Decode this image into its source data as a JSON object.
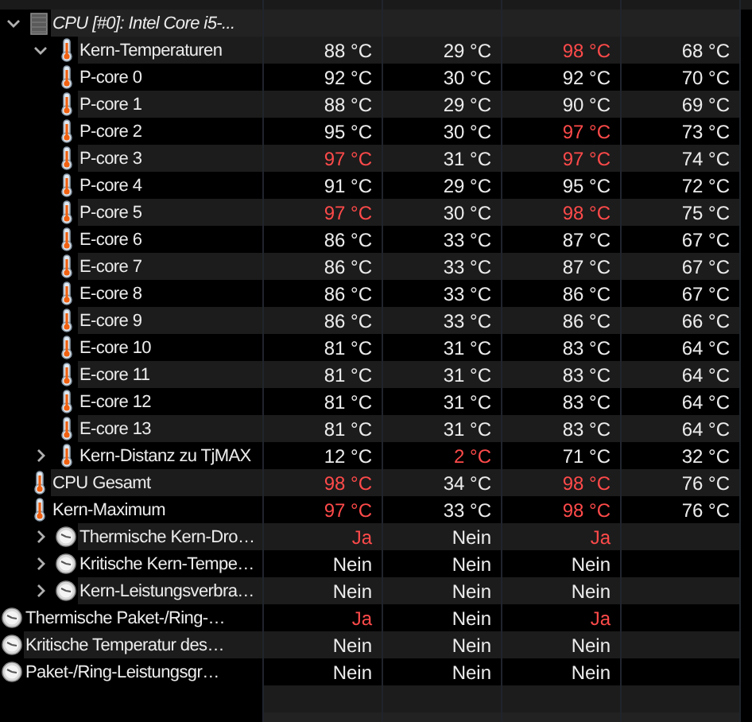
{
  "tree": [
    {
      "label": "CPU [#0]: Intel Core i5-...",
      "kind": "group",
      "expanded": true,
      "children": [
        {
          "label": "Kern-Temperaturen",
          "kind": "temperature",
          "expanded": true,
          "values": [
            {
              "text": "88 °C",
              "alert": false
            },
            {
              "text": "29 °C",
              "alert": false
            },
            {
              "text": "98 °C",
              "alert": true
            },
            {
              "text": "68 °C",
              "alert": false
            }
          ],
          "children": [
            {
              "label": "P-core 0",
              "kind": "temperature",
              "values": [
                {
                  "text": "92 °C",
                  "alert": false
                },
                {
                  "text": "30 °C",
                  "alert": false
                },
                {
                  "text": "92 °C",
                  "alert": false
                },
                {
                  "text": "70 °C",
                  "alert": false
                }
              ]
            },
            {
              "label": "P-core 1",
              "kind": "temperature",
              "values": [
                {
                  "text": "88 °C",
                  "alert": false
                },
                {
                  "text": "29 °C",
                  "alert": false
                },
                {
                  "text": "90 °C",
                  "alert": false
                },
                {
                  "text": "69 °C",
                  "alert": false
                }
              ]
            },
            {
              "label": "P-core 2",
              "kind": "temperature",
              "values": [
                {
                  "text": "95 °C",
                  "alert": false
                },
                {
                  "text": "30 °C",
                  "alert": false
                },
                {
                  "text": "97 °C",
                  "alert": true
                },
                {
                  "text": "73 °C",
                  "alert": false
                }
              ]
            },
            {
              "label": "P-core 3",
              "kind": "temperature",
              "values": [
                {
                  "text": "97 °C",
                  "alert": true
                },
                {
                  "text": "31 °C",
                  "alert": false
                },
                {
                  "text": "97 °C",
                  "alert": true
                },
                {
                  "text": "74 °C",
                  "alert": false
                }
              ]
            },
            {
              "label": "P-core 4",
              "kind": "temperature",
              "values": [
                {
                  "text": "91 °C",
                  "alert": false
                },
                {
                  "text": "29 °C",
                  "alert": false
                },
                {
                  "text": "95 °C",
                  "alert": false
                },
                {
                  "text": "72 °C",
                  "alert": false
                }
              ]
            },
            {
              "label": "P-core 5",
              "kind": "temperature",
              "values": [
                {
                  "text": "97 °C",
                  "alert": true
                },
                {
                  "text": "30 °C",
                  "alert": false
                },
                {
                  "text": "98 °C",
                  "alert": true
                },
                {
                  "text": "75 °C",
                  "alert": false
                }
              ]
            },
            {
              "label": "E-core 6",
              "kind": "temperature",
              "values": [
                {
                  "text": "86 °C",
                  "alert": false
                },
                {
                  "text": "33 °C",
                  "alert": false
                },
                {
                  "text": "87 °C",
                  "alert": false
                },
                {
                  "text": "67 °C",
                  "alert": false
                }
              ]
            },
            {
              "label": "E-core 7",
              "kind": "temperature",
              "values": [
                {
                  "text": "86 °C",
                  "alert": false
                },
                {
                  "text": "33 °C",
                  "alert": false
                },
                {
                  "text": "87 °C",
                  "alert": false
                },
                {
                  "text": "67 °C",
                  "alert": false
                }
              ]
            },
            {
              "label": "E-core 8",
              "kind": "temperature",
              "values": [
                {
                  "text": "86 °C",
                  "alert": false
                },
                {
                  "text": "33 °C",
                  "alert": false
                },
                {
                  "text": "86 °C",
                  "alert": false
                },
                {
                  "text": "67 °C",
                  "alert": false
                }
              ]
            },
            {
              "label": "E-core 9",
              "kind": "temperature",
              "values": [
                {
                  "text": "86 °C",
                  "alert": false
                },
                {
                  "text": "33 °C",
                  "alert": false
                },
                {
                  "text": "86 °C",
                  "alert": false
                },
                {
                  "text": "66 °C",
                  "alert": false
                }
              ]
            },
            {
              "label": "E-core 10",
              "kind": "temperature",
              "values": [
                {
                  "text": "81 °C",
                  "alert": false
                },
                {
                  "text": "31 °C",
                  "alert": false
                },
                {
                  "text": "83 °C",
                  "alert": false
                },
                {
                  "text": "64 °C",
                  "alert": false
                }
              ]
            },
            {
              "label": "E-core 11",
              "kind": "temperature",
              "values": [
                {
                  "text": "81 °C",
                  "alert": false
                },
                {
                  "text": "31 °C",
                  "alert": false
                },
                {
                  "text": "83 °C",
                  "alert": false
                },
                {
                  "text": "64 °C",
                  "alert": false
                }
              ]
            },
            {
              "label": "E-core 12",
              "kind": "temperature",
              "values": [
                {
                  "text": "81 °C",
                  "alert": false
                },
                {
                  "text": "31 °C",
                  "alert": false
                },
                {
                  "text": "83 °C",
                  "alert": false
                },
                {
                  "text": "64 °C",
                  "alert": false
                }
              ]
            },
            {
              "label": "E-core 13",
              "kind": "temperature",
              "values": [
                {
                  "text": "81 °C",
                  "alert": false
                },
                {
                  "text": "31 °C",
                  "alert": false
                },
                {
                  "text": "83 °C",
                  "alert": false
                },
                {
                  "text": "64 °C",
                  "alert": false
                }
              ]
            }
          ]
        },
        {
          "label": "Kern-Distanz zu TjMAX",
          "kind": "temperature",
          "expanded": false,
          "values": [
            {
              "text": "12 °C",
              "alert": false
            },
            {
              "text": "2 °C",
              "alert": true
            },
            {
              "text": "71 °C",
              "alert": false
            },
            {
              "text": "32 °C",
              "alert": false
            }
          ]
        },
        {
          "label": "CPU Gesamt",
          "kind": "temperature",
          "values": [
            {
              "text": "98 °C",
              "alert": true
            },
            {
              "text": "34 °C",
              "alert": false
            },
            {
              "text": "98 °C",
              "alert": true
            },
            {
              "text": "76 °C",
              "alert": false
            }
          ]
        },
        {
          "label": "Kern-Maximum",
          "kind": "temperature",
          "values": [
            {
              "text": "97 °C",
              "alert": true
            },
            {
              "text": "33 °C",
              "alert": false
            },
            {
              "text": "98 °C",
              "alert": true
            },
            {
              "text": "76 °C",
              "alert": false
            }
          ]
        },
        {
          "label": "Thermische Kern-Dro…",
          "kind": "flag",
          "expanded": false,
          "values": [
            {
              "text": "Ja",
              "alert": true
            },
            {
              "text": "Nein",
              "alert": false
            },
            {
              "text": "Ja",
              "alert": true
            }
          ]
        },
        {
          "label": "Kritische Kern-Tempe…",
          "kind": "flag",
          "expanded": false,
          "values": [
            {
              "text": "Nein",
              "alert": false
            },
            {
              "text": "Nein",
              "alert": false
            },
            {
              "text": "Nein",
              "alert": false
            }
          ]
        },
        {
          "label": "Kern-Leistungsverbra…",
          "kind": "flag",
          "expanded": false,
          "values": [
            {
              "text": "Nein",
              "alert": false
            },
            {
              "text": "Nein",
              "alert": false
            },
            {
              "text": "Nein",
              "alert": false
            }
          ]
        }
      ]
    },
    {
      "label": "Thermische Paket-/Ring-…",
      "kind": "flag",
      "values": [
        {
          "text": "Ja",
          "alert": true
        },
        {
          "text": "Nein",
          "alert": false
        },
        {
          "text": "Ja",
          "alert": true
        }
      ]
    },
    {
      "label": "Kritische Temperatur des…",
      "kind": "flag",
      "values": [
        {
          "text": "Nein",
          "alert": false
        },
        {
          "text": "Nein",
          "alert": false
        },
        {
          "text": "Nein",
          "alert": false
        }
      ]
    },
    {
      "label": "Paket-/Ring-Leistungsgr…",
      "kind": "flag",
      "values": [
        {
          "text": "Nein",
          "alert": false
        },
        {
          "text": "Nein",
          "alert": false
        },
        {
          "text": "Nein",
          "alert": false
        }
      ]
    }
  ]
}
